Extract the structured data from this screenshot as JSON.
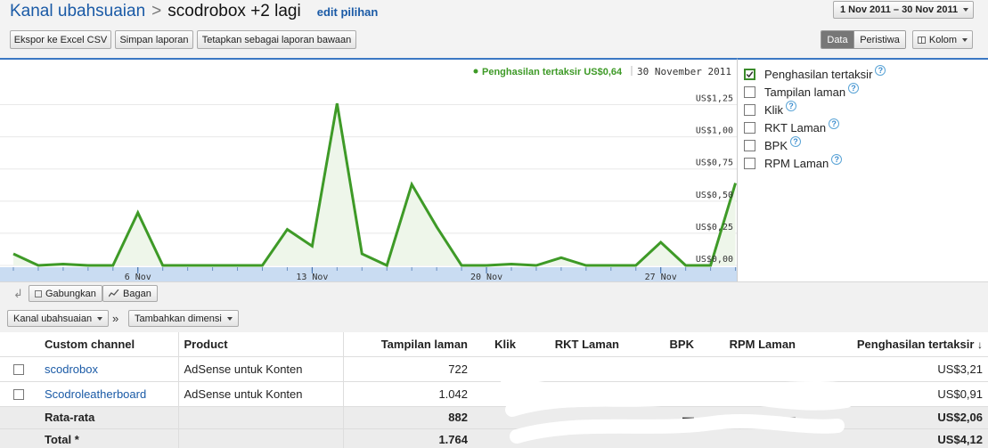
{
  "header": {
    "breadcrumb_link": "Kanal ubahsuaian",
    "breadcrumb_sep": ">",
    "current": "scodrobox +2 lagi",
    "edit_link": "edit pilihan",
    "date_range": "1 Nov 2011 – 30 Nov 2011"
  },
  "toolbar": {
    "export_label": "Ekspor ke Excel CSV",
    "save_label": "Simpan laporan",
    "default_label": "Tetapkan sebagai laporan bawaan",
    "data_tab": "Data",
    "events_tab": "Peristiwa",
    "columns_label": "Kolom"
  },
  "chart_data": {
    "type": "line",
    "legend_label": "Penghasilan tertaksir US$0,64",
    "legend_date": "30 November 2011",
    "x": [
      1,
      2,
      3,
      4,
      5,
      6,
      7,
      8,
      9,
      10,
      11,
      12,
      13,
      14,
      15,
      16,
      17,
      18,
      19,
      20,
      21,
      22,
      23,
      24,
      25,
      26,
      27,
      28,
      29,
      30
    ],
    "x_ticks": [
      {
        "x": 6,
        "label": "6 Nov"
      },
      {
        "x": 13,
        "label": "13 Nov"
      },
      {
        "x": 20,
        "label": "20 Nov"
      },
      {
        "x": 27,
        "label": "27 Nov"
      }
    ],
    "series": [
      {
        "color": "#3e9a27",
        "values": [
          0.09,
          0,
          0.01,
          0,
          0,
          0.41,
          0,
          0,
          0,
          0,
          0,
          0.28,
          0.15,
          1.26,
          0.09,
          0,
          0.63,
          0.3,
          0,
          0,
          0.01,
          0,
          0.06,
          0,
          0,
          0,
          0.18,
          0,
          0,
          0.64
        ]
      }
    ],
    "y_ticks": [
      {
        "value": 0,
        "label": "US$0,00"
      },
      {
        "value": 0.25,
        "label": "US$0,25"
      },
      {
        "value": 0.5,
        "label": "US$0,50"
      },
      {
        "value": 0.75,
        "label": "US$0,75"
      },
      {
        "value": 1.0,
        "label": "US$1,00"
      },
      {
        "value": 1.25,
        "label": "US$1,25"
      }
    ],
    "ylim": [
      0,
      1.42
    ],
    "grid": true
  },
  "metrics": [
    {
      "label": "Penghasilan tertaksir",
      "checked": true
    },
    {
      "label": "Tampilan laman",
      "checked": false
    },
    {
      "label": "Klik",
      "checked": false
    },
    {
      "label": "RKT Laman",
      "checked": false
    },
    {
      "label": "BPK",
      "checked": false
    },
    {
      "label": "RPM Laman",
      "checked": false
    }
  ],
  "help_glyph": "?",
  "midbar": {
    "combine_label": "Gabungkan",
    "chart_label": "Bagan",
    "dimension_select": "Kanal ubahsuaian",
    "separator": "»",
    "add_dimension_label": "Tambahkan dimensi"
  },
  "table": {
    "columns": [
      "Custom channel",
      "Product",
      "Tampilan laman",
      "Klik",
      "RKT Laman",
      "BPK",
      "RPM Laman",
      "Penghasilan tertaksir"
    ],
    "sort_arrow": "↓",
    "rows": [
      {
        "channel": "scodrobox",
        "product": "AdSense untuk Konten",
        "views": "722",
        "clicks": "",
        "ctr": "",
        "cpc": "",
        "rpm": "",
        "earnings": "US$3,21"
      },
      {
        "channel": "Scodroleatherboard",
        "product": "AdSense untuk Konten",
        "views": "1.042",
        "clicks": "",
        "ctr": "",
        "cpc": "",
        "rpm": "",
        "earnings": "US$0,91"
      }
    ],
    "average": {
      "label": "Rata-rata",
      "views": "882",
      "clicks": "",
      "ctr": "",
      "cpc": "—",
      "rpm": "—",
      "earnings": "US$2,06"
    },
    "total": {
      "label": "Total *",
      "views": "1.764",
      "clicks": "",
      "ctr": "",
      "cpc": "",
      "rpm": "",
      "earnings": "US$4,12"
    }
  },
  "colors": {
    "accent": "#1a5aa6",
    "series": "#3e9a27",
    "chart_border": "#3b78c3"
  }
}
